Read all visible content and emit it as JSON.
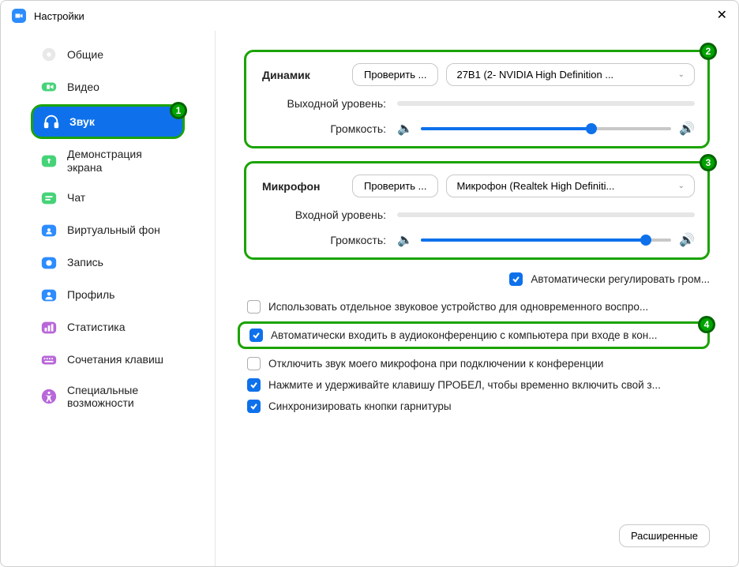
{
  "titlebar": {
    "title": "Настройки"
  },
  "sidebar": {
    "items": [
      {
        "label": "Общие",
        "icon": "gear"
      },
      {
        "label": "Видео",
        "icon": "video"
      },
      {
        "label": "Звук",
        "icon": "audio",
        "active": true
      },
      {
        "label": "Демонстрация экрана",
        "icon": "share"
      },
      {
        "label": "Чат",
        "icon": "chat"
      },
      {
        "label": "Виртуальный фон",
        "icon": "vbg"
      },
      {
        "label": "Запись",
        "icon": "record"
      },
      {
        "label": "Профиль",
        "icon": "profile"
      },
      {
        "label": "Статистика",
        "icon": "stats"
      },
      {
        "label": "Сочетания клавиш",
        "icon": "keys"
      },
      {
        "label": "Специальные возможности",
        "icon": "acc"
      }
    ]
  },
  "speaker": {
    "title": "Динамик",
    "test_btn": "Проверить ...",
    "device": "27B1 (2- NVIDIA High Definition ...",
    "output_level_label": "Выходной уровень:",
    "volume_label": "Громкость:",
    "volume_pct": 68
  },
  "mic": {
    "title": "Микрофон",
    "test_btn": "Проверить ...",
    "device": "Микрофон (Realtek High Definiti...",
    "input_level_label": "Входной уровень:",
    "volume_label": "Громкость:",
    "volume_pct": 90,
    "auto_adjust": "Автоматически регулировать гром..."
  },
  "checks": {
    "separate_device": "Использовать отдельное звуковое устройство для одновременного воспро...",
    "auto_join_audio": "Автоматически входить в аудиоконференцию с компьютера при входе в кон...",
    "mute_mic_on_join": "Отключить звук моего микрофона при подключении к конференции",
    "push_to_talk": "Нажмите и удерживайте клавишу ПРОБЕЛ, чтобы временно включить свой з...",
    "sync_headset": "Синхронизировать кнопки гарнитуры"
  },
  "advanced_btn": "Расширенные",
  "annotations": {
    "b1": "1",
    "b2": "2",
    "b3": "3",
    "b4": "4"
  }
}
